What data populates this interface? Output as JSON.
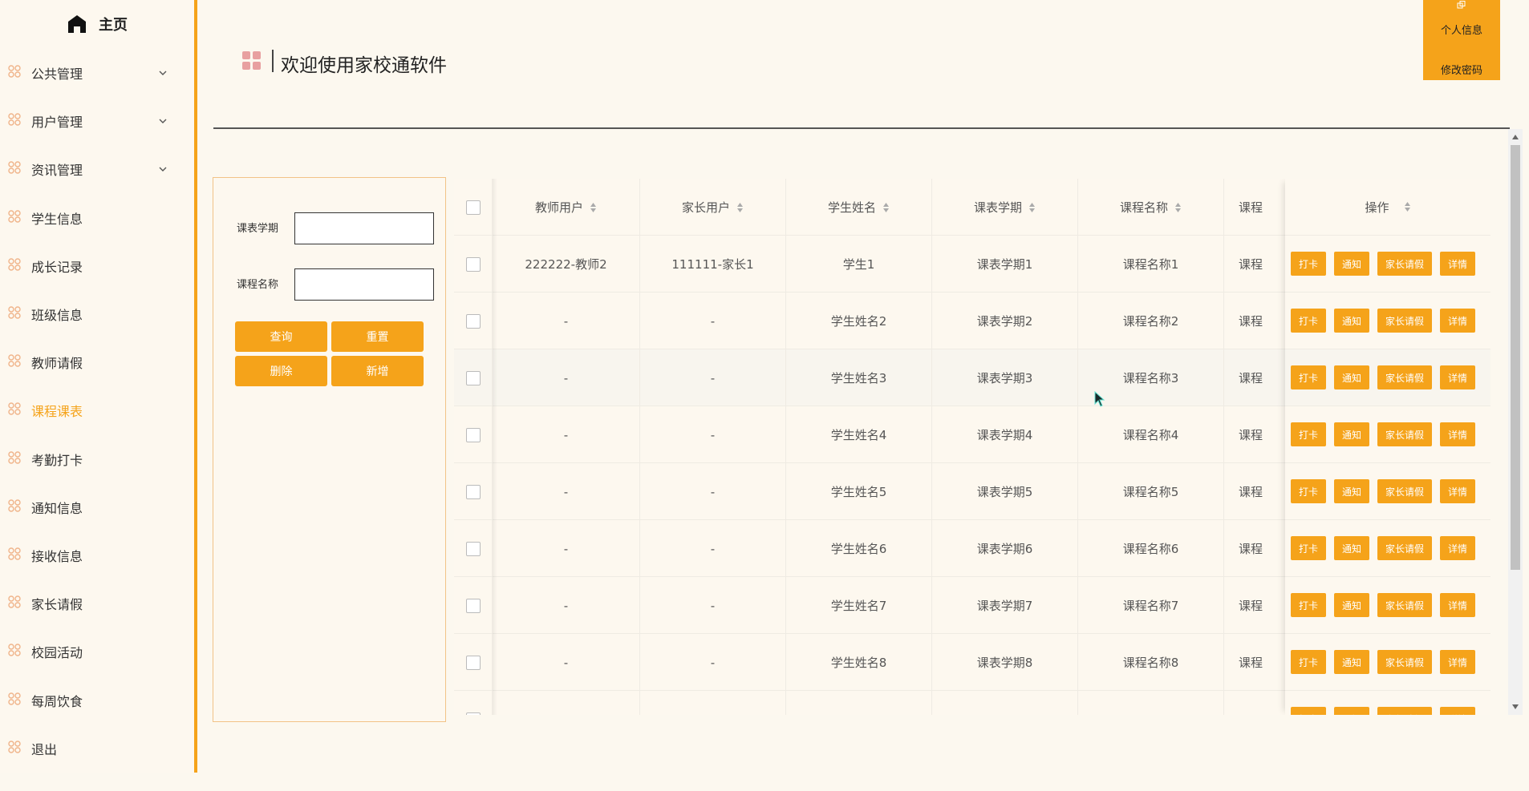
{
  "sidebar": {
    "home_label": "主页",
    "items": [
      {
        "label": "公共管理",
        "has_arrow": true
      },
      {
        "label": "用户管理",
        "has_arrow": true
      },
      {
        "label": "资讯管理",
        "has_arrow": true
      },
      {
        "label": "学生信息",
        "has_arrow": false
      },
      {
        "label": "成长记录",
        "has_arrow": false
      },
      {
        "label": "班级信息",
        "has_arrow": false
      },
      {
        "label": "教师请假",
        "has_arrow": false
      },
      {
        "label": "课程课表",
        "has_arrow": false,
        "active": true
      },
      {
        "label": "考勤打卡",
        "has_arrow": false
      },
      {
        "label": "通知信息",
        "has_arrow": false
      },
      {
        "label": "接收信息",
        "has_arrow": false
      },
      {
        "label": "家长请假",
        "has_arrow": false
      },
      {
        "label": "校园活动",
        "has_arrow": false
      },
      {
        "label": "每周饮食",
        "has_arrow": false
      },
      {
        "label": "退出",
        "has_arrow": false
      }
    ]
  },
  "header": {
    "title": "欢迎使用家校通软件"
  },
  "user_menu": {
    "profile": "个人信息",
    "change_password": "修改密码"
  },
  "search": {
    "term_label": "课表学期",
    "term_value": "",
    "course_label": "课程名称",
    "course_value": "",
    "query_button": "查询",
    "reset_button": "重置",
    "delete_button": "删除",
    "add_button": "新增"
  },
  "table": {
    "columns": [
      "教师用户",
      "家长用户",
      "学生姓名",
      "课表学期",
      "课程名称",
      "课程"
    ],
    "ops_header": "操作",
    "op_labels": {
      "checkin": "打卡",
      "notify": "通知",
      "leave": "家长请假",
      "detail": "详情"
    },
    "rows": [
      [
        "222222-教师2",
        "111111-家长1",
        "学生1",
        "课表学期1",
        "课程名称1",
        "课程"
      ],
      [
        "-",
        "-",
        "学生姓名2",
        "课表学期2",
        "课程名称2",
        "课程"
      ],
      [
        "-",
        "-",
        "学生姓名3",
        "课表学期3",
        "课程名称3",
        "课程"
      ],
      [
        "-",
        "-",
        "学生姓名4",
        "课表学期4",
        "课程名称4",
        "课程"
      ],
      [
        "-",
        "-",
        "学生姓名5",
        "课表学期5",
        "课程名称5",
        "课程"
      ],
      [
        "-",
        "-",
        "学生姓名6",
        "课表学期6",
        "课程名称6",
        "课程"
      ],
      [
        "-",
        "-",
        "学生姓名7",
        "课表学期7",
        "课程名称7",
        "课程"
      ],
      [
        "-",
        "-",
        "学生姓名8",
        "课表学期8",
        "课程名称8",
        "课程"
      ],
      [
        "",
        "",
        "",
        "",
        "",
        ""
      ]
    ]
  },
  "colors": {
    "accent": "#f5a31a",
    "background": "#fcf8ef",
    "text": "#333333"
  }
}
